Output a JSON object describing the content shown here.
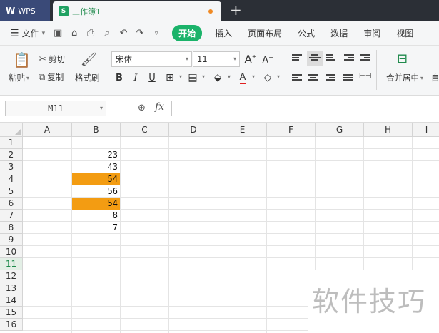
{
  "titlebar": {
    "app_tab": "WPS",
    "doc_tab": "工作簿1",
    "doc_icon": "S",
    "new_tab": "+"
  },
  "menubar": {
    "file": "文件",
    "tabs": [
      "开始",
      "插入",
      "页面布局",
      "公式",
      "数据",
      "审阅",
      "视图"
    ],
    "active_tab": "开始"
  },
  "ribbon": {
    "paste": "粘贴",
    "cut": "剪切",
    "copy": "复制",
    "format_painter": "格式刷",
    "font_name": "宋体",
    "font_size": "11",
    "merge_center": "合并居中",
    "bold": "B",
    "italic": "I",
    "underline": "U",
    "grow_font": "A",
    "shrink_font": "A",
    "font_color": "A"
  },
  "formula_bar": {
    "name_box": "M11",
    "fx": "fx",
    "value": ""
  },
  "sheet": {
    "columns": [
      "A",
      "B",
      "C",
      "D",
      "E",
      "F",
      "G",
      "H",
      "I"
    ],
    "rows": [
      "1",
      "2",
      "3",
      "4",
      "5",
      "6",
      "7",
      "8",
      "9",
      "10",
      "11",
      "12",
      "13",
      "14",
      "15",
      "16"
    ],
    "selected_row": "11",
    "column_b_values": [
      "23",
      "43",
      "54",
      "56",
      "54",
      "8",
      "7"
    ],
    "highlight_color": "#f39c12"
  },
  "watermark": "软件技巧",
  "colors": {
    "accent": "#1bb36a",
    "titlebar": "#2b2f36",
    "highlight": "#f39c12"
  }
}
